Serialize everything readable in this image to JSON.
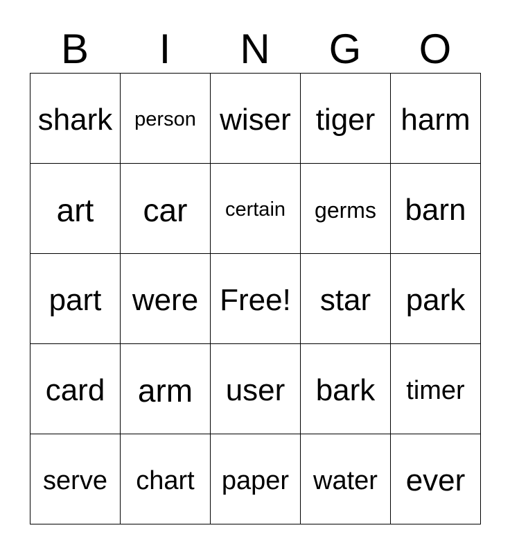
{
  "card": {
    "title": "BINGO",
    "columns": [
      "B",
      "I",
      "N",
      "G",
      "O"
    ],
    "free_space_label": "Free!",
    "text_color": "#000000",
    "background_color": "#ffffff",
    "border_color": "#000000",
    "rows": 5,
    "cols": 5,
    "cells": [
      [
        {
          "text": "shark",
          "size": "lg"
        },
        {
          "text": "person",
          "size": "xs"
        },
        {
          "text": "wiser",
          "size": "lg"
        },
        {
          "text": "tiger",
          "size": "lg"
        },
        {
          "text": "harm",
          "size": "lg"
        }
      ],
      [
        {
          "text": "art",
          "size": "xl"
        },
        {
          "text": "car",
          "size": "xl"
        },
        {
          "text": "certain",
          "size": "xs"
        },
        {
          "text": "germs",
          "size": "sm"
        },
        {
          "text": "barn",
          "size": "lg"
        }
      ],
      [
        {
          "text": "part",
          "size": "lg"
        },
        {
          "text": "were",
          "size": "lg"
        },
        {
          "text": "Free!",
          "size": "lg"
        },
        {
          "text": "star",
          "size": "lg"
        },
        {
          "text": "park",
          "size": "lg"
        }
      ],
      [
        {
          "text": "card",
          "size": "lg"
        },
        {
          "text": "arm",
          "size": "xl"
        },
        {
          "text": "user",
          "size": "lg"
        },
        {
          "text": "bark",
          "size": "lg"
        },
        {
          "text": "timer",
          "size": "md"
        }
      ],
      [
        {
          "text": "serve",
          "size": "md"
        },
        {
          "text": "chart",
          "size": "md"
        },
        {
          "text": "paper",
          "size": "md"
        },
        {
          "text": "water",
          "size": "md"
        },
        {
          "text": "ever",
          "size": "lg"
        }
      ]
    ]
  }
}
